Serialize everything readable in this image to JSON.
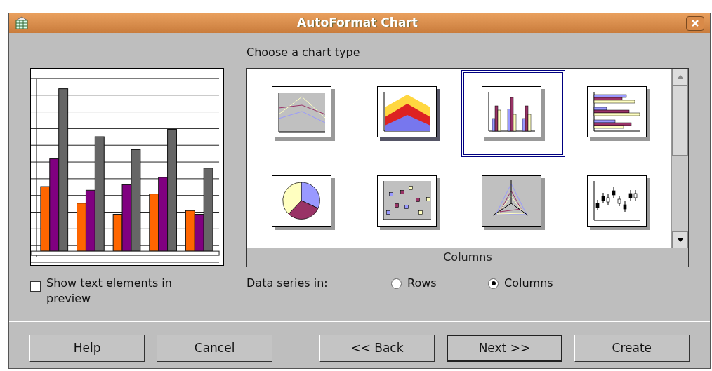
{
  "window": {
    "title": "AutoFormat Chart"
  },
  "chart_type_label": "Choose a chart type",
  "chart_types": [
    {
      "kind": "line",
      "selected": false
    },
    {
      "kind": "area",
      "selected": false
    },
    {
      "kind": "column",
      "selected": true
    },
    {
      "kind": "bar",
      "selected": false
    },
    {
      "kind": "pie",
      "selected": false
    },
    {
      "kind": "scatter",
      "selected": false
    },
    {
      "kind": "net",
      "selected": false
    },
    {
      "kind": "stock",
      "selected": false
    }
  ],
  "selected_type_name": "Columns",
  "show_text_elements": {
    "label": "Show text elements in preview",
    "checked": false
  },
  "data_series": {
    "label": "Data series in:",
    "options": [
      {
        "label": "Rows",
        "selected": false
      },
      {
        "label": "Columns",
        "selected": true
      }
    ]
  },
  "buttons": [
    {
      "label": "Help",
      "default": false
    },
    {
      "label": "Cancel",
      "default": false
    },
    {
      "label": "<< Back",
      "default": false
    },
    {
      "label": "Next >>",
      "default": true
    },
    {
      "label": "Create",
      "default": false
    }
  ]
}
